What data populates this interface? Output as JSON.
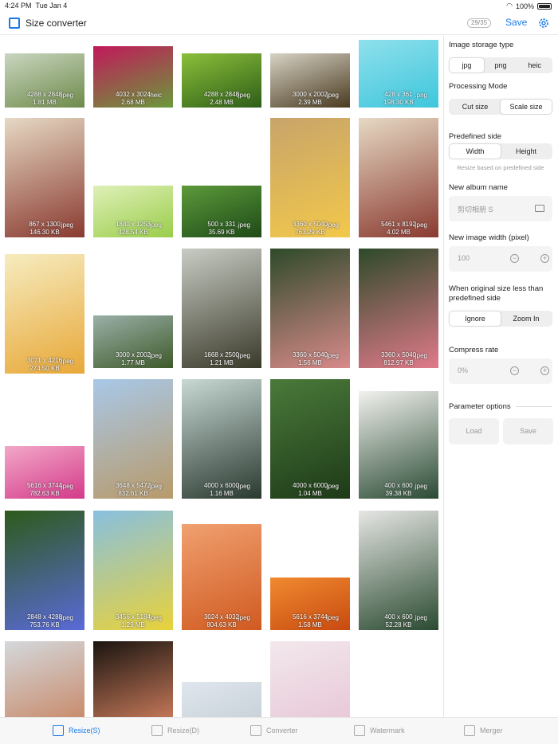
{
  "status": {
    "time": "4:24 PM",
    "date": "Tue Jan 4",
    "battery": "100%"
  },
  "header": {
    "title": "Size converter",
    "count": "29/35",
    "save_label": "Save"
  },
  "thumbs": [
    {
      "res": "4288 x 2848",
      "size": "1.81 MB",
      "fmt": ".jpeg",
      "colors": [
        "#c9d6c0",
        "#6e8a4a"
      ]
    },
    {
      "res": "4032 x 3024",
      "size": "2.68 MB",
      "fmt": ".heic",
      "colors": [
        "#c2185b",
        "#6a9a3a"
      ]
    },
    {
      "res": "4288 x 2848",
      "size": "2.48 MB",
      "fmt": ".jpeg",
      "colors": [
        "#8bbf3a",
        "#2e5e18"
      ]
    },
    {
      "res": "3000 x 2002",
      "size": "2.39 MB",
      "fmt": ".jpeg",
      "colors": [
        "#d6d2c4",
        "#4a3a20"
      ]
    },
    {
      "res": "428 x 361",
      "size": "198.30 KB",
      "fmt": ".png",
      "colors": [
        "#8fe0ec",
        "#3ec6dc"
      ]
    },
    {
      "res": "867 x 1300",
      "size": "146.30 KB",
      "fmt": ".jpeg",
      "colors": [
        "#e6d9c4",
        "#8a3a30"
      ]
    },
    {
      "res": "1880 x 1253",
      "size": "428.54 KB",
      "fmt": ".jpeg",
      "colors": [
        "#dff0b8",
        "#9acd4a"
      ]
    },
    {
      "res": "500 x 331",
      "size": "35.69 KB",
      "fmt": ".jpeg",
      "colors": [
        "#5c9a3a",
        "#1e4a18"
      ]
    },
    {
      "res": "3360 x 5040",
      "size": "763.29 KB",
      "fmt": ".jpeg",
      "colors": [
        "#c8a46a",
        "#f2c84a"
      ]
    },
    {
      "res": "5461 x 8192",
      "size": "4.02 MB",
      "fmt": ".jpeg",
      "colors": [
        "#e6d9c4",
        "#8a3a30"
      ]
    },
    {
      "res": "3071 x 4216",
      "size": "274.50 KB",
      "fmt": ".jpeg",
      "colors": [
        "#f6ecc0",
        "#e8a838"
      ]
    },
    {
      "res": "3000 x 2002",
      "size": "1.77 MB",
      "fmt": ".jpeg",
      "colors": [
        "#9ab0a8",
        "#3e5a2a"
      ]
    },
    {
      "res": "1668 x 2500",
      "size": "1.21 MB",
      "fmt": ".jpeg",
      "colors": [
        "#c8ccc4",
        "#3a3a2a"
      ]
    },
    {
      "res": "3360 x 5040",
      "size": "1.56 MB",
      "fmt": ".jpeg",
      "colors": [
        "#2e4a2a",
        "#d88a8a"
      ]
    },
    {
      "res": "3360 x 5040",
      "size": "812.97 KB",
      "fmt": ".jpeg",
      "colors": [
        "#2e4a2a",
        "#e07a8a"
      ]
    },
    {
      "res": "5616 x 3744",
      "size": "782.63 KB",
      "fmt": ".jpeg",
      "colors": [
        "#f2a8c8",
        "#d43a8a"
      ]
    },
    {
      "res": "3648 x 5472",
      "size": "832.61 KB",
      "fmt": ".jpeg",
      "colors": [
        "#a8c8e8",
        "#b89a6a"
      ]
    },
    {
      "res": "4000 x 6000",
      "size": "1.16 MB",
      "fmt": ".jpeg",
      "colors": [
        "#c8d8d4",
        "#2a3a30"
      ]
    },
    {
      "res": "4000 x 6000",
      "size": "1.04 MB",
      "fmt": ".jpeg",
      "colors": [
        "#4a7a3a",
        "#1e3a18"
      ]
    },
    {
      "res": "400 x 600",
      "size": "39.38 KB",
      "fmt": ".jpeg",
      "colors": [
        "#f2f2ee",
        "#2a4a34"
      ]
    },
    {
      "res": "2848 x 4288",
      "size": "753.76 KB",
      "fmt": ".jpeg",
      "colors": [
        "#2e5a1a",
        "#5a6ad8"
      ]
    },
    {
      "res": "3456 x 5184",
      "size": "1.29 MB",
      "fmt": ".jpeg",
      "colors": [
        "#88c0e0",
        "#e8d23a"
      ]
    },
    {
      "res": "3024 x 4032",
      "size": "804.63 KB",
      "fmt": ".jpeg",
      "colors": [
        "#f0a070",
        "#d05a20"
      ]
    },
    {
      "res": "5616 x 3744",
      "size": "1.58 MB",
      "fmt": ".jpeg",
      "colors": [
        "#f08a30",
        "#c84a10"
      ]
    },
    {
      "res": "400 x 600",
      "size": "52.28 KB",
      "fmt": ".jpeg",
      "colors": [
        "#e6e6e4",
        "#2a4a30"
      ]
    },
    {
      "res": "",
      "size": "",
      "fmt": "",
      "colors": [
        "#d4d8dc",
        "#c88a6a"
      ]
    },
    {
      "res": "",
      "size": "",
      "fmt": "",
      "colors": [
        "#1a1410",
        "#c87a5a"
      ]
    },
    {
      "res": "",
      "size": "",
      "fmt": "",
      "colors": [
        "#dfe6ee",
        "#c8d0d8"
      ]
    },
    {
      "res": "",
      "size": "",
      "fmt": "",
      "colors": [
        "#f2e8ec",
        "#e8c8d8"
      ]
    }
  ],
  "panel": {
    "storage_label": "Image storage type",
    "storage_options": [
      "jpg",
      "png",
      "heic"
    ],
    "mode_label": "Processing Mode",
    "mode_options": [
      "Cut size",
      "Scale size"
    ],
    "side_label": "Predefined side",
    "side_options": [
      "Width",
      "Height"
    ],
    "side_hint": "Resize based on predefined side",
    "album_label": "New album name",
    "album_placeholder": "剪切相册 S",
    "width_label": "New image width (pixel)",
    "width_value": "100",
    "less_label": "When original size less than predefined side",
    "less_options": [
      "Ignore",
      "Zoom In"
    ],
    "compress_label": "Compress rate",
    "compress_value": "0%",
    "params_label": "Parameter options",
    "load_label": "Load",
    "save_label": "Save"
  },
  "tabs": [
    {
      "label": "Resize(S)",
      "active": true
    },
    {
      "label": "Resize(D)",
      "active": false
    },
    {
      "label": "Converter",
      "active": false
    },
    {
      "label": "Watermark",
      "active": false
    },
    {
      "label": "Merger",
      "active": false
    }
  ],
  "colors": {
    "accent": "#1a7be8"
  }
}
